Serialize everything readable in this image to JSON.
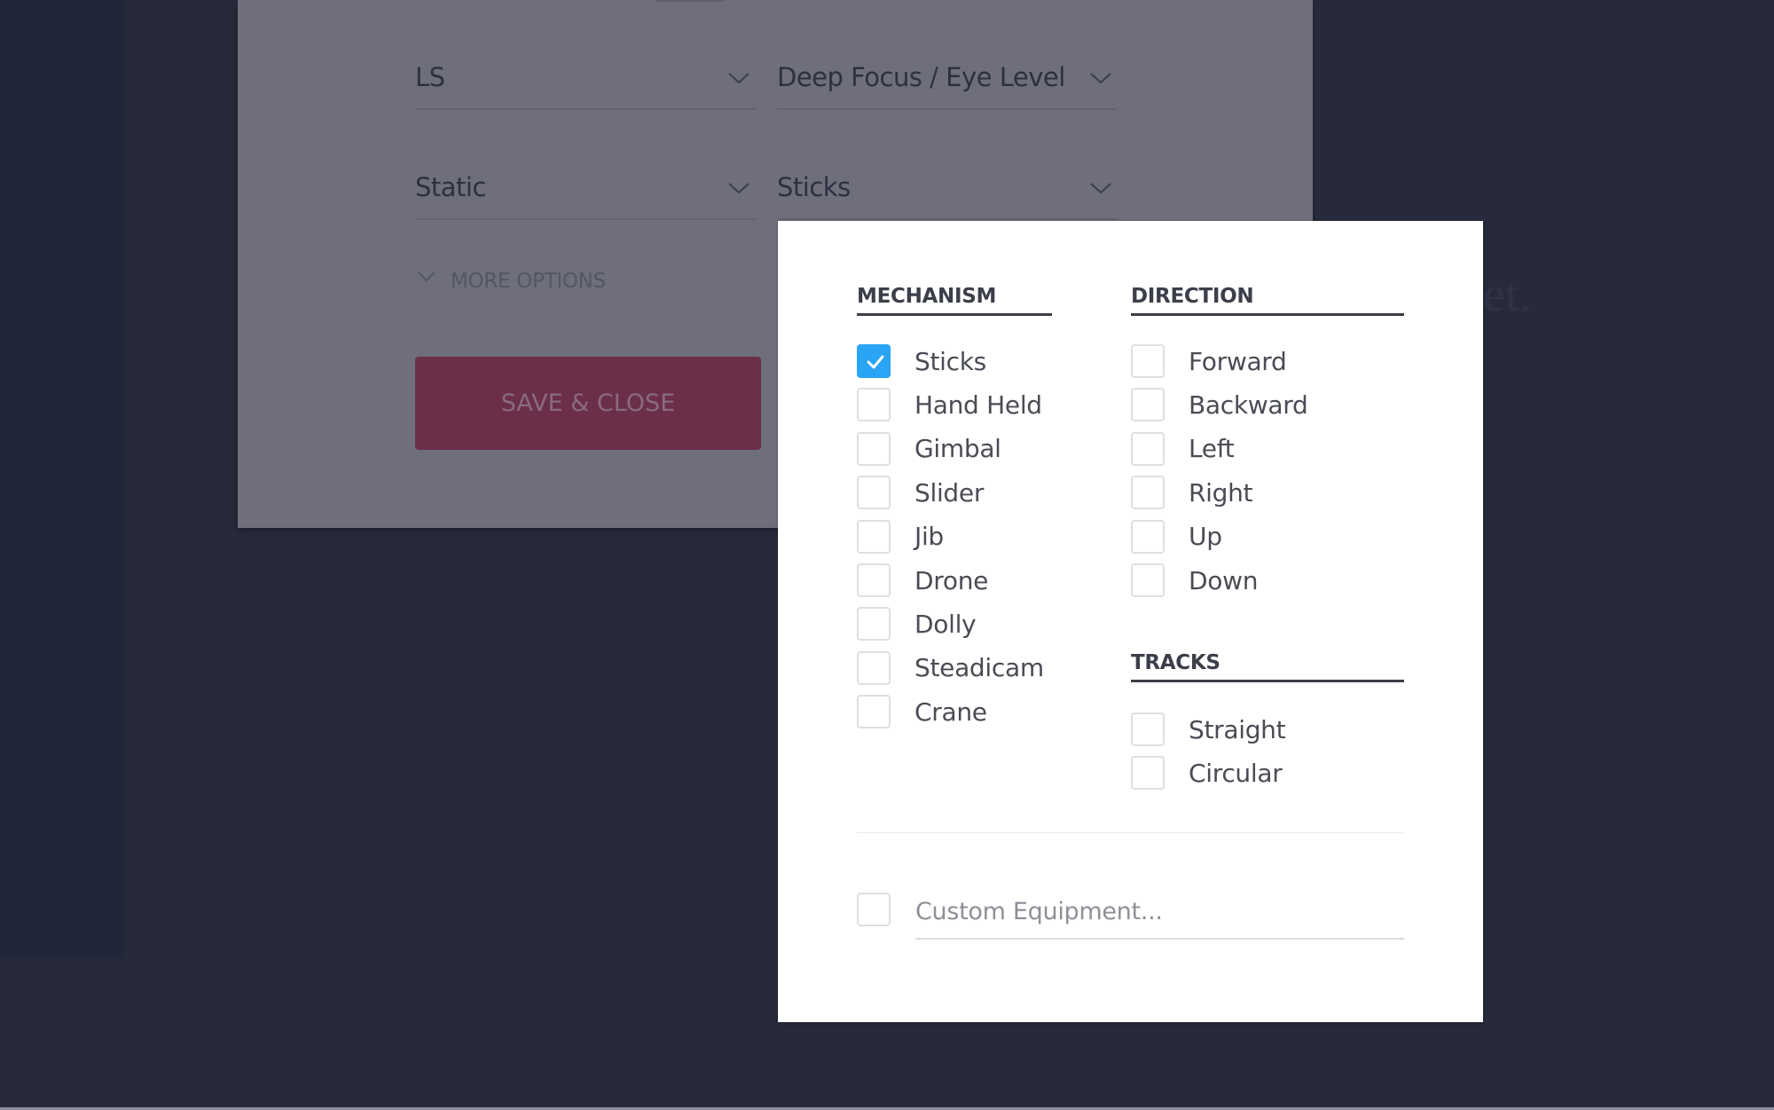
{
  "background": {
    "ghost_text_right": "et."
  },
  "shot_form": {
    "fields": [
      {
        "name": "shot-size-select",
        "value": "LS"
      },
      {
        "name": "focus-angle-select",
        "value": "Deep Focus / Eye Level"
      },
      {
        "name": "movement-select",
        "value": "Static"
      },
      {
        "name": "equipment-select",
        "value": "Sticks"
      }
    ],
    "more_options_label": "MORE OPTIONS",
    "save_label": "SAVE & CLOSE"
  },
  "equipment_popup": {
    "mechanism": {
      "title": "MECHANISM",
      "options": [
        {
          "label": "Sticks",
          "checked": true
        },
        {
          "label": "Hand Held",
          "checked": false
        },
        {
          "label": "Gimbal",
          "checked": false
        },
        {
          "label": "Slider",
          "checked": false
        },
        {
          "label": "Jib",
          "checked": false
        },
        {
          "label": "Drone",
          "checked": false
        },
        {
          "label": "Dolly",
          "checked": false
        },
        {
          "label": "Steadicam",
          "checked": false
        },
        {
          "label": "Crane",
          "checked": false
        }
      ]
    },
    "direction": {
      "title": "DIRECTION",
      "options": [
        {
          "label": "Forward",
          "checked": false
        },
        {
          "label": "Backward",
          "checked": false
        },
        {
          "label": "Left",
          "checked": false
        },
        {
          "label": "Right",
          "checked": false
        },
        {
          "label": "Up",
          "checked": false
        },
        {
          "label": "Down",
          "checked": false
        }
      ]
    },
    "tracks": {
      "title": "TRACKS",
      "options": [
        {
          "label": "Straight",
          "checked": false
        },
        {
          "label": "Circular",
          "checked": false
        }
      ]
    },
    "custom": {
      "checked": false,
      "placeholder": "Custom Equipment...",
      "value": ""
    }
  },
  "colors": {
    "accent_checked": "#2aa4f4",
    "save_button": "#6b2f4a",
    "overlay_card": "#6f6f7b",
    "page_bg": "#262a3a"
  }
}
